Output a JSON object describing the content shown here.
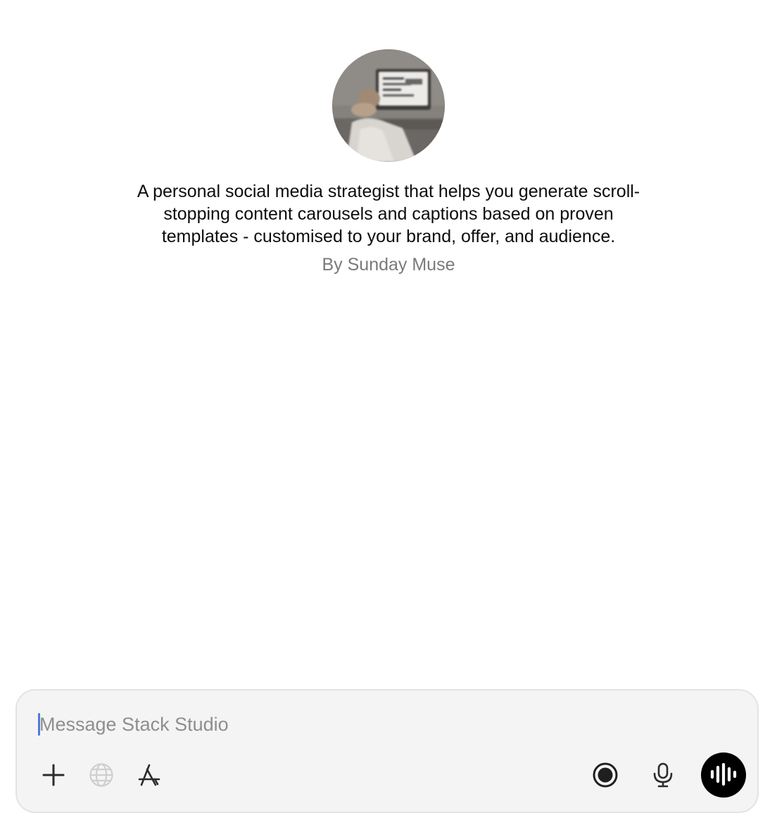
{
  "gpt": {
    "description": "A personal social media strategist that helps you generate scroll-stopping content carousels and captions based on proven templates - customised to your brand, offer, and audience.",
    "author": "By Sunday Muse"
  },
  "composer": {
    "placeholder": "Message Stack Studio"
  },
  "icons": {
    "attach": "plus-icon",
    "web": "globe-icon",
    "tools": "app-store-icon",
    "record": "record-icon",
    "dictate": "microphone-icon",
    "voice": "voice-waveform-icon"
  },
  "colors": {
    "composer_bg": "#f4f4f4",
    "voice_button": "#000000",
    "muted_text": "#7a7a7a",
    "caret": "#4f7bd8"
  }
}
